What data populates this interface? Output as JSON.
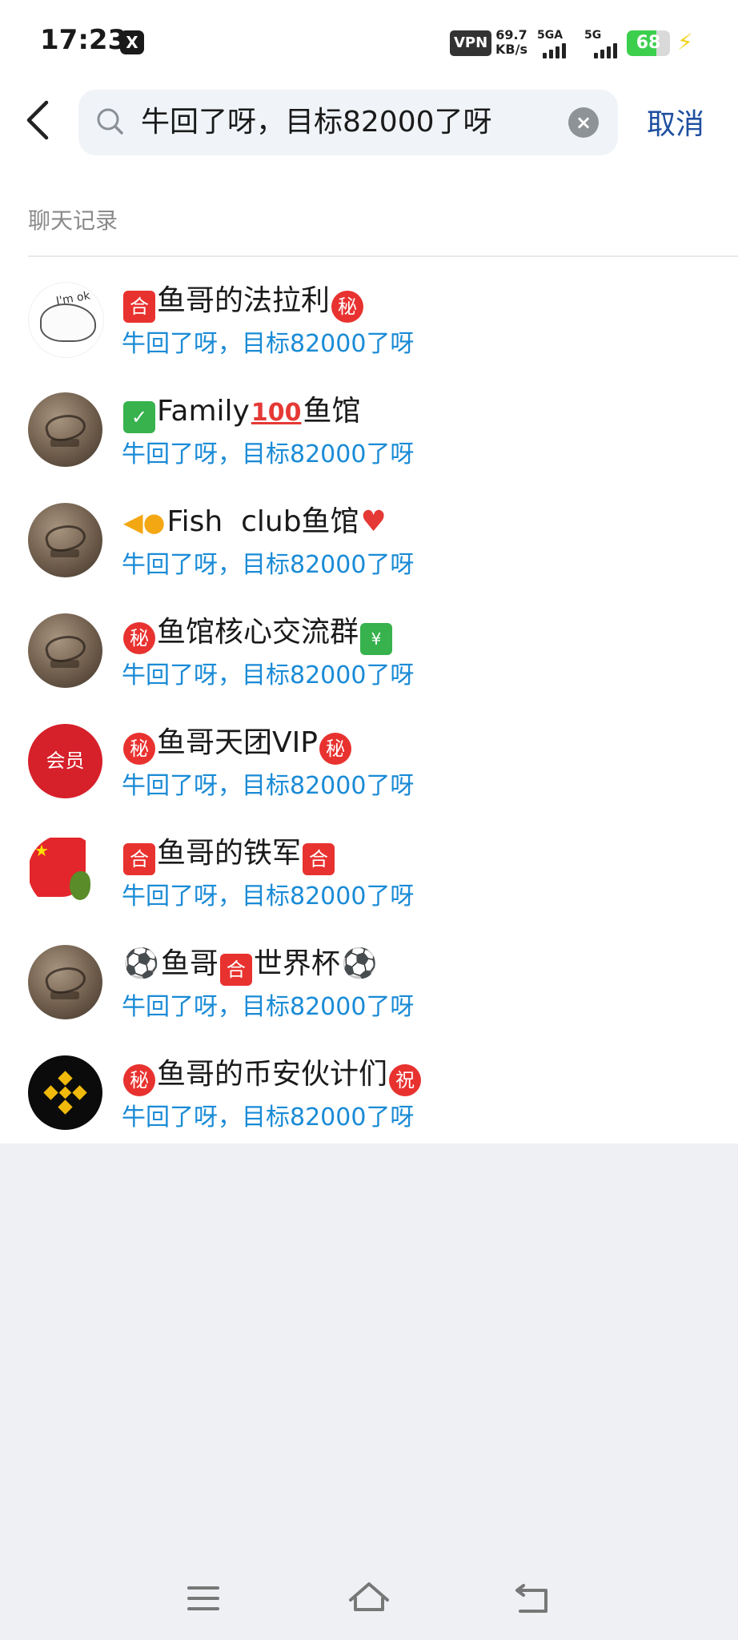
{
  "status_bar": {
    "time": "17:23",
    "vpn": "VPN",
    "speed_value": "69.7",
    "speed_unit": "KB/s",
    "sim1_label": "5GA",
    "sim2_label": "5G",
    "battery": "68",
    "battery_level": 0.68
  },
  "search": {
    "query": "牛回了呀，目标82000了呀",
    "cancel_label": "取消"
  },
  "section_title": "聊天记录",
  "results": [
    {
      "title": [
        "🈴",
        "鱼哥的法拉利",
        "㊙"
      ],
      "snippet": "牛回了呀，目标82000了呀"
    },
    {
      "title": [
        "✅",
        "Family",
        "💯",
        "鱼馆"
      ],
      "snippet": "牛回了呀，目标82000了呀"
    },
    {
      "title": [
        "🐠",
        "Fish  club鱼馆",
        "❤️"
      ],
      "snippet": "牛回了呀，目标82000了呀"
    },
    {
      "title": [
        "㊙",
        "鱼馆核心交流群",
        "💹"
      ],
      "snippet": "牛回了呀，目标82000了呀"
    },
    {
      "title": [
        "㊙",
        "鱼哥天团VIP",
        "㊙"
      ],
      "snippet": "牛回了呀，目标82000了呀",
      "avatar_text": "会员"
    },
    {
      "title": [
        "🈴",
        "鱼哥的铁军",
        "🈴"
      ],
      "snippet": "牛回了呀，目标82000了呀"
    },
    {
      "title": [
        "⚽",
        "鱼哥",
        "🈴",
        "世界杯",
        "⚽"
      ],
      "snippet": "牛回了呀，目标82000了呀"
    },
    {
      "title": [
        "㊙",
        "鱼哥的币安伙计们",
        "㊗"
      ],
      "snippet": "牛回了呀，目标82000了呀"
    }
  ],
  "badges": {
    "he": "合",
    "mi": "秘",
    "zhu": "祝",
    "check": "✓",
    "hundred": "100",
    "chart": "¥"
  },
  "icons": {
    "x_icon": "X",
    "clear_icon": "×",
    "heart": "♥",
    "fish": "◀●",
    "ball": "⚽"
  },
  "colors": {
    "accent": "#1f4fa0",
    "snippet": "#1a8bd6",
    "badge_red": "#e8322f",
    "battery": "#3ccf4e"
  }
}
